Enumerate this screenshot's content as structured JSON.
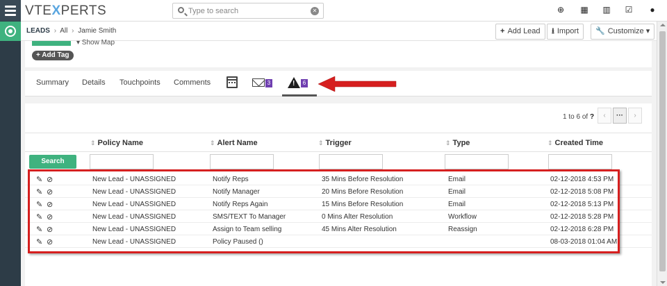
{
  "brand": {
    "logo_pre": "VTE",
    "logo_x": "X",
    "logo_post": "PERTS"
  },
  "search": {
    "placeholder": "Type to search"
  },
  "top_icons": [
    "plus-circle-icon",
    "calendar-icon",
    "bar-chart-icon",
    "checkbox-icon",
    "user-icon"
  ],
  "breadcrumb": {
    "module": "LEADS",
    "all": "All",
    "record": "Jamie Smith"
  },
  "header_buttons": {
    "add_lead": "Add Lead",
    "import": "Import",
    "customize": "Customize"
  },
  "summary": {
    "show_map": "▾ Show Map",
    "add_tag": "+ Add Tag"
  },
  "tabs": [
    {
      "label": "Summary"
    },
    {
      "label": "Details"
    },
    {
      "label": "Touchpoints"
    },
    {
      "label": "Comments"
    }
  ],
  "tab_badges": {
    "mail_count": "3",
    "alerts_count": "6"
  },
  "pager": {
    "range": "1 to 6",
    "of": "of",
    "total": "?",
    "prev": "‹",
    "more": "···",
    "next": "›"
  },
  "table": {
    "columns": [
      "Policy Name",
      "Alert Name",
      "Trigger",
      "Type",
      "Created Time"
    ],
    "search_label": "Search",
    "rows": [
      {
        "policy": "New Lead - UNASSIGNED",
        "alert": "Notify Reps",
        "trigger": "35 Mins Before Resolution",
        "type": "Email",
        "created": "02-12-2018 4:53 PM"
      },
      {
        "policy": "New Lead - UNASSIGNED",
        "alert": "Notify Manager",
        "trigger": "20 Mins Before Resolution",
        "type": "Email",
        "created": "02-12-2018 5:08 PM"
      },
      {
        "policy": "New Lead - UNASSIGNED",
        "alert": "Notify Reps Again",
        "trigger": "15 Mins Before Resolution",
        "type": "Email",
        "created": "02-12-2018 5:13 PM"
      },
      {
        "policy": "New Lead - UNASSIGNED",
        "alert": "SMS/TEXT To Manager",
        "trigger": "0 Mins Alter Resolution",
        "type": "Workflow",
        "created": "02-12-2018 5:28 PM"
      },
      {
        "policy": "New Lead - UNASSIGNED",
        "alert": "Assign to Team selling",
        "trigger": "45 Mins Alter Resolution",
        "type": "Reassign",
        "created": "02-12-2018 6:28 PM"
      },
      {
        "policy": "New Lead - UNASSIGNED",
        "alert": "Policy Paused ()",
        "trigger": "",
        "type": "",
        "created": "08-03-2018 01:04 AM"
      }
    ]
  },
  "colors": {
    "accent_green": "#3fb27f",
    "sidebar": "#2d3c47",
    "badge_purple": "#6f3fb0",
    "annotation_red": "#d61f1f"
  }
}
